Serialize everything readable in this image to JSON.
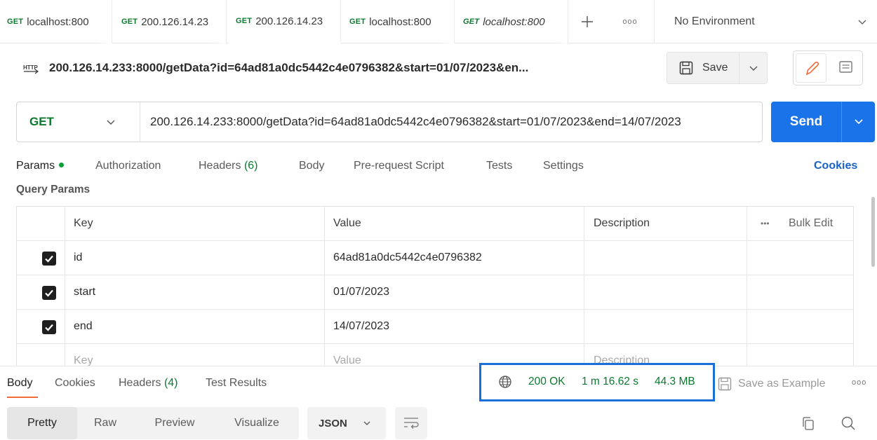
{
  "tabs": [
    {
      "method": "GET",
      "url": "localhost:800",
      "italic": false
    },
    {
      "method": "GET",
      "url": "200.126.14.23",
      "italic": false
    },
    {
      "method": "GET",
      "url": "200.126.14.23",
      "italic": false
    },
    {
      "method": "GET",
      "url": "localhost:800",
      "italic": false
    },
    {
      "method": "GET",
      "url": "localhost:800",
      "italic": true
    }
  ],
  "tab_more": "ooo",
  "environment": {
    "label": "No Environment"
  },
  "request": {
    "title": "200.126.14.233:8000/getData?id=64ad81a0dc5442c4e0796382&start=01/07/2023&en...",
    "save_label": "Save",
    "method": "GET",
    "url": "200.126.14.233:8000/getData?id=64ad81a0dc5442c4e0796382&start=01/07/2023&end=14/07/2023",
    "send_label": "Send"
  },
  "request_tabs": {
    "params": "Params",
    "authorization": "Authorization",
    "headers": "Headers",
    "headers_count": "(6)",
    "body": "Body",
    "prerequest": "Pre-request Script",
    "tests": "Tests",
    "settings": "Settings",
    "cookies": "Cookies"
  },
  "query_params": {
    "title": "Query Params",
    "headers": {
      "key": "Key",
      "value": "Value",
      "description": "Description",
      "more": "•••",
      "bulk_edit": "Bulk Edit"
    },
    "rows": [
      {
        "key": "id",
        "value": "64ad81a0dc5442c4e0796382",
        "checked": true
      },
      {
        "key": "start",
        "value": "01/07/2023",
        "checked": true
      },
      {
        "key": "end",
        "value": "14/07/2023",
        "checked": true
      }
    ],
    "placeholder": {
      "key": "Key",
      "value": "Value",
      "description": "Description"
    }
  },
  "response": {
    "tabs": {
      "body": "Body",
      "cookies": "Cookies",
      "headers": "Headers",
      "headers_count": "(4)",
      "test_results": "Test Results"
    },
    "status": "200 OK",
    "time": "1 m 16.62 s",
    "size": "44.3 MB",
    "save_example": "Save as Example",
    "more": "ooo",
    "views": [
      "Pretty",
      "Raw",
      "Preview",
      "Visualize"
    ],
    "format": "JSON"
  },
  "colors": {
    "accent_blue": "#1a73e8",
    "get_green": "#0b7a2e",
    "highlight_box": "#1a6fd8",
    "active_underline": "#f26b3a"
  }
}
